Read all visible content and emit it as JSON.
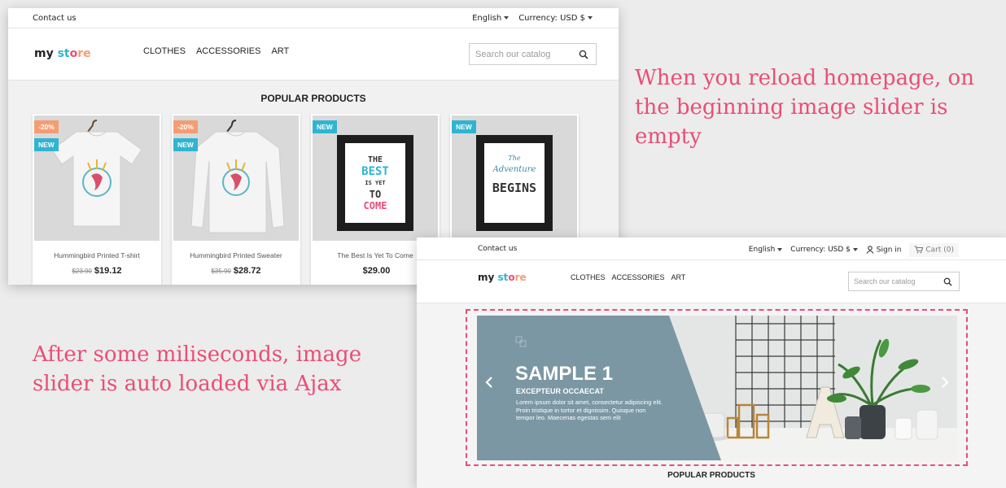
{
  "shot_before": {
    "topbar": {
      "contact": "Contact us",
      "language": "English",
      "currency": "Currency: USD $"
    },
    "logo": {
      "part1": "my",
      "part2": " st",
      "part3": "o",
      "part4": "re"
    },
    "nav": [
      "CLOTHES",
      "ACCESSORIES",
      "ART"
    ],
    "search": {
      "placeholder": "Search our catalog"
    },
    "section_title": "POPULAR PRODUCTS",
    "products": [
      {
        "name": "Hummingbird Printed T-shirt",
        "old_price": "$23.90",
        "price": "$19.12",
        "discount": "-20%",
        "new": "NEW"
      },
      {
        "name": "Hummingbird Printed Sweater",
        "old_price": "$35.90",
        "price": "$28.72",
        "discount": "-20%",
        "new": "NEW"
      },
      {
        "name": "The Best Is Yet To Come",
        "price": "$29.00",
        "new": "NEW",
        "poster": [
          "THE",
          "BEST",
          "IS YET",
          "TO",
          "COME"
        ]
      },
      {
        "new": "NEW",
        "poster": [
          "The",
          "Adventure",
          "BEGINS"
        ]
      }
    ]
  },
  "shot_after": {
    "topbar": {
      "contact": "Contact us",
      "language": "English",
      "currency": "Currency: USD $",
      "signin": "Sign in",
      "cart": "Cart (0)"
    },
    "logo": {
      "part1": "my",
      "part2": " st",
      "part3": "o",
      "part4": "re"
    },
    "nav": [
      "CLOTHES",
      "ACCESSORIES",
      "ART"
    ],
    "search": {
      "placeholder": "Search our catalog"
    },
    "slide": {
      "title": "SAMPLE 1",
      "subtitle": "EXCEPTEUR OCCAECAT",
      "body": "Lorem ipsum dolor sit amet, consectetur adipiscing elit. Proin tristique in tortor et dignissim. Quisque non tempor leo. Maecenas egestas sem elit",
      "panel_color": "#7b97a3"
    },
    "section_title": "POPULAR PRODUCTS"
  },
  "annotations": {
    "before": "When you reload homepage, on the beginning image slider is empty",
    "after": "After some miliseconds, image slider is auto loaded via Ajax"
  },
  "colors": {
    "accent": "#e94e77",
    "brand_blue": "#2fb5d2",
    "brand_orange": "#f39d72"
  }
}
